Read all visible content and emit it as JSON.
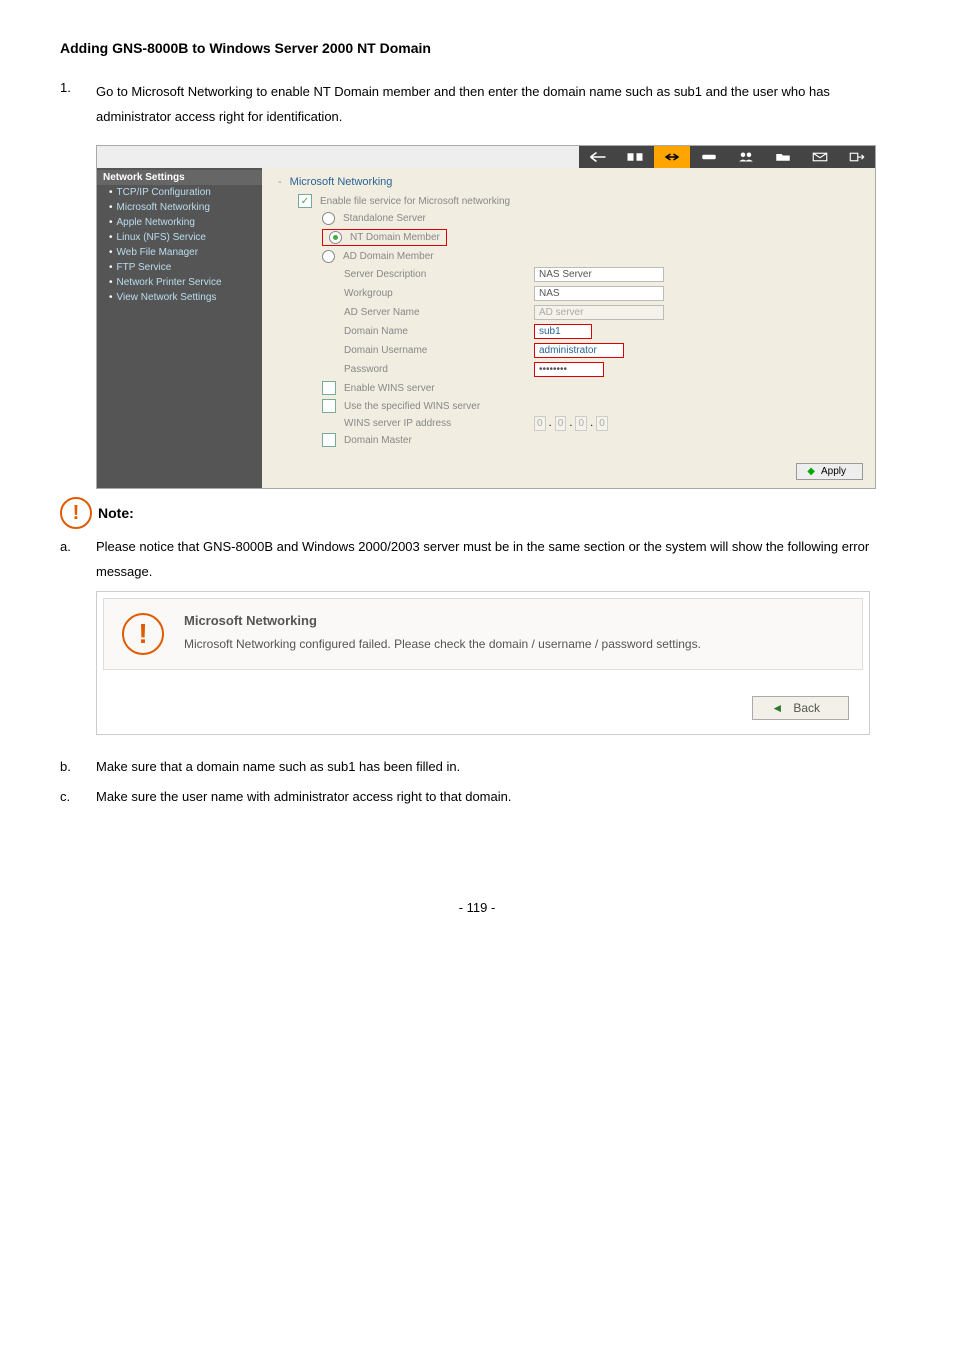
{
  "title": "Adding GNS-8000B to Windows Server 2000 NT Domain",
  "step1": {
    "num": "1.",
    "text": "Go to Microsoft Networking to enable NT Domain member and then enter the domain name such as sub1 and the user who has administrator access right for identification."
  },
  "sidebar": {
    "header": "Network Settings",
    "items": [
      "TCP/IP Configuration",
      "Microsoft Networking",
      "Apple Networking",
      "Linux (NFS) Service",
      "Web File Manager",
      "FTP Service",
      "Network Printer Service",
      "View Network Settings"
    ]
  },
  "form": {
    "title": "Microsoft Networking",
    "enable_label": "Enable file service for Microsoft networking",
    "standalone": "Standalone Server",
    "nt_member": "NT Domain Member",
    "ad_member": "AD Domain Member",
    "server_desc_label": "Server Description",
    "server_desc_value": "NAS Server",
    "workgroup_label": "Workgroup",
    "workgroup_value": "NAS",
    "ad_server_label": "AD Server Name",
    "ad_server_value": "AD server",
    "domain_name_label": "Domain Name",
    "domain_name_value": "sub1",
    "domain_user_label": "Domain Username",
    "domain_user_value": "administrator",
    "password_label": "Password",
    "password_value": "••••••••",
    "wins_enable": "Enable WINS server",
    "wins_specified": "Use the specified WINS server",
    "wins_ip_label": "WINS server IP address",
    "wins_ip_oct": "0",
    "domain_master": "Domain Master",
    "apply": "Apply"
  },
  "note_label": "Note:",
  "note_a": {
    "letter": "a.",
    "text": "Please notice that GNS-8000B and Windows 2000/2003 server must be in the same section or the system will show the following error message."
  },
  "error": {
    "heading": "Microsoft Networking",
    "body": "Microsoft Networking configured failed. Please check the domain / username / password settings.",
    "back": "Back"
  },
  "note_b": {
    "letter": "b.",
    "text": "Make sure that a domain name such as sub1 has been filled in."
  },
  "note_c": {
    "letter": "c.",
    "text": "Make sure the user name with administrator access right to that domain."
  },
  "page_number": "- 119 -"
}
